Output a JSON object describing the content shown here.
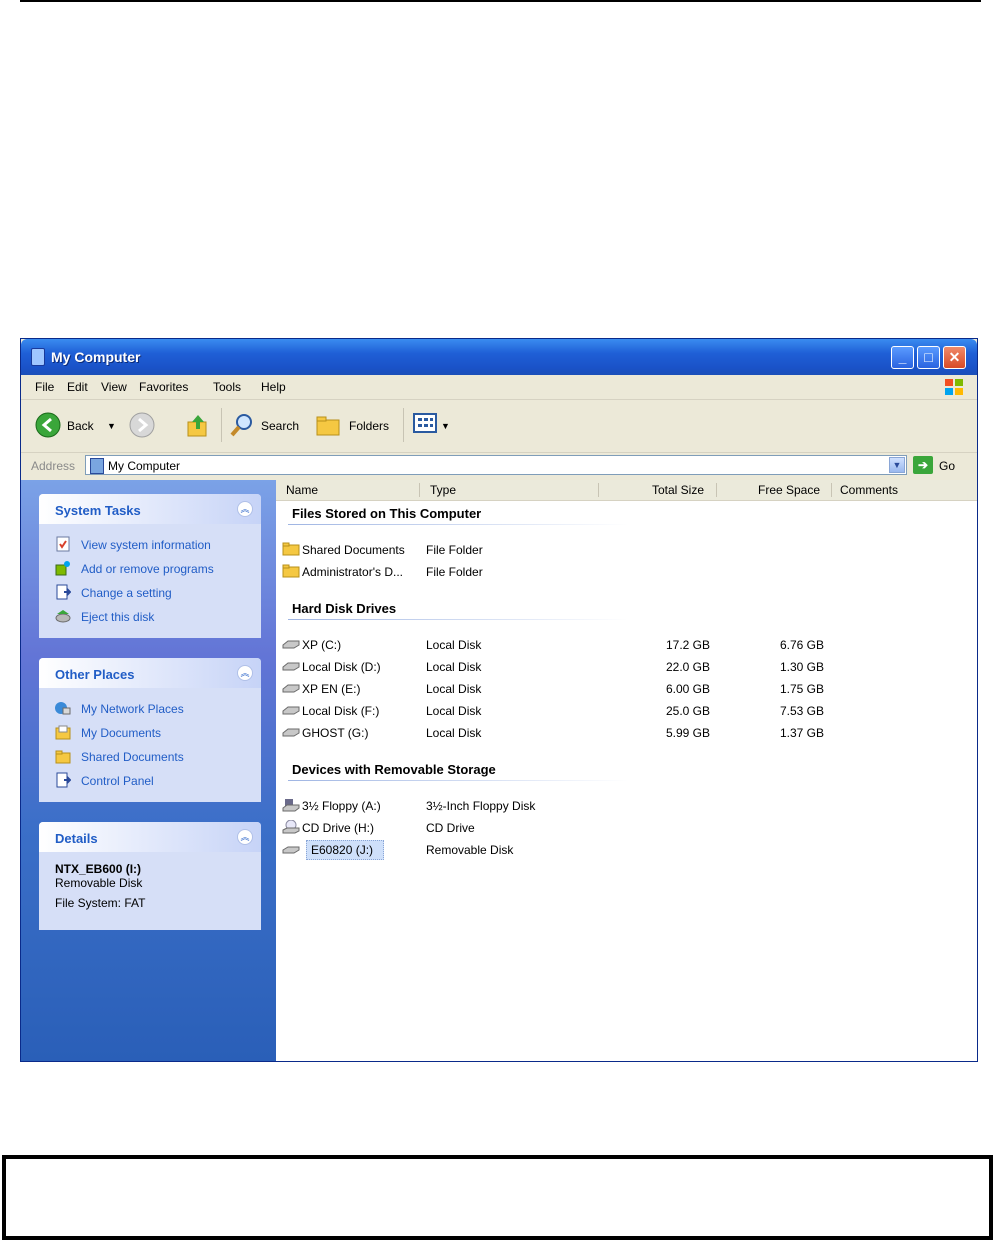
{
  "window": {
    "title": "My Computer"
  },
  "menu": [
    "File",
    "Edit",
    "View",
    "Favorites",
    "Tools",
    "Help"
  ],
  "toolbar": {
    "back_label": "Back",
    "search_label": "Search",
    "folders_label": "Folders"
  },
  "address": {
    "label": "Address",
    "value": "My Computer",
    "go_label": "Go"
  },
  "system_tasks": {
    "title": "System Tasks",
    "items": [
      "View system information",
      "Add or remove programs",
      "Change a setting",
      "Eject this disk"
    ]
  },
  "other_places": {
    "title": "Other Places",
    "items": [
      "My Network Places",
      "My Documents",
      "Shared Documents",
      "Control Panel"
    ]
  },
  "details": {
    "title": "Details",
    "name": "NTX_EB600 (I:)",
    "type": "Removable Disk",
    "filesystem": "File System: FAT"
  },
  "columns": [
    "Name",
    "Type",
    "Total Size",
    "Free Space",
    "Comments"
  ],
  "groups": [
    {
      "title": "Files Stored on This Computer",
      "rows": [
        {
          "name": "Shared Documents",
          "type": "File Folder",
          "total": "",
          "free": "",
          "icon": "folder-icon"
        },
        {
          "name": "Administrator's D...",
          "type": "File Folder",
          "total": "",
          "free": "",
          "icon": "folder-icon"
        }
      ]
    },
    {
      "title": "Hard Disk Drives",
      "rows": [
        {
          "name": "XP (C:)",
          "type": "Local Disk",
          "total": "17.2 GB",
          "free": "6.76 GB",
          "icon": "disk-icon"
        },
        {
          "name": "Local Disk (D:)",
          "type": "Local Disk",
          "total": "22.0 GB",
          "free": "1.30 GB",
          "icon": "disk-icon"
        },
        {
          "name": "XP EN (E:)",
          "type": "Local Disk",
          "total": "6.00 GB",
          "free": "1.75 GB",
          "icon": "disk-icon"
        },
        {
          "name": "Local Disk (F:)",
          "type": "Local Disk",
          "total": "25.0 GB",
          "free": "7.53 GB",
          "icon": "disk-icon"
        },
        {
          "name": "GHOST (G:)",
          "type": "Local Disk",
          "total": "5.99 GB",
          "free": "1.37 GB",
          "icon": "disk-icon"
        }
      ]
    },
    {
      "title": "Devices with Removable Storage",
      "rows": [
        {
          "name": "3½ Floppy (A:)",
          "type": "3½-Inch Floppy Disk",
          "total": "",
          "free": "",
          "icon": "floppy-icon"
        },
        {
          "name": "CD Drive (H:)",
          "type": "CD Drive",
          "total": "",
          "free": "",
          "icon": "cd-drive-icon"
        },
        {
          "name": "E60820 (J:)",
          "type": "Removable Disk",
          "total": "",
          "free": "",
          "icon": "removable-disk-icon",
          "selected": true
        }
      ]
    }
  ]
}
